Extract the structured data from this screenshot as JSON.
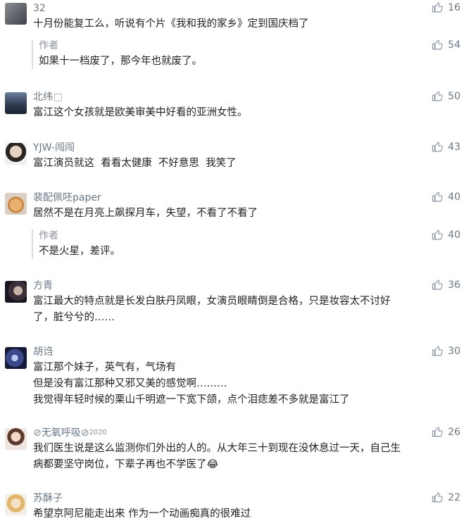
{
  "like_icon": "thumbs-up-icon",
  "comments": [
    {
      "name": "32",
      "text": "十月份能复工么，听说有个片《我和我的家乡》定到国庆档了",
      "likes": "16",
      "reply": {
        "name": "作者",
        "text": "如果十一档废了，那今年也就废了。",
        "likes": "54"
      }
    },
    {
      "name": "北纬",
      "text": "富江这个女孩就是欧美审美中好看的亚洲女性。",
      "likes": "50"
    },
    {
      "name": "YJW-闯闯",
      "text": "富江演员就这  看看太健康  不好意思  我笑了",
      "likes": "43"
    },
    {
      "name": "裴配佩呸paper",
      "text": "居然不是在月亮上飙探月车，失望，不看了不看了",
      "likes": "40",
      "reply": {
        "name": "作者",
        "text": "不是火星，差评。",
        "likes": "40"
      }
    },
    {
      "name": "方青",
      "text_lines": [
        "富江最大的特点就是长发白肤丹凤眼，女演员眼睛倒是合格，只是妆容太不讨好",
        "了，脏兮兮的……"
      ],
      "likes": "36"
    },
    {
      "name": "胡诌",
      "text_lines": [
        "富江那个妹子，英气有，气场有",
        "但是没有富江那种又邪又美的感觉啊………",
        "我觉得年轻时候的栗山千明遮一下宽下颌，点个泪痣差不多就是富江了"
      ],
      "likes": "30"
    },
    {
      "name": "无氧呼吸",
      "name_sup": "2020",
      "text_lines": [
        "我们医生说是这么监测你们外出的人的。从大年三十到现在没休息过一天，自己生",
        "病都要坚守岗位，下辈子再也不学医了"
      ],
      "likes": "26"
    },
    {
      "name": "苏酥子",
      "text": "希望京阿尼能走出来 作为一个动画痴真的很难过",
      "likes": "22"
    }
  ]
}
